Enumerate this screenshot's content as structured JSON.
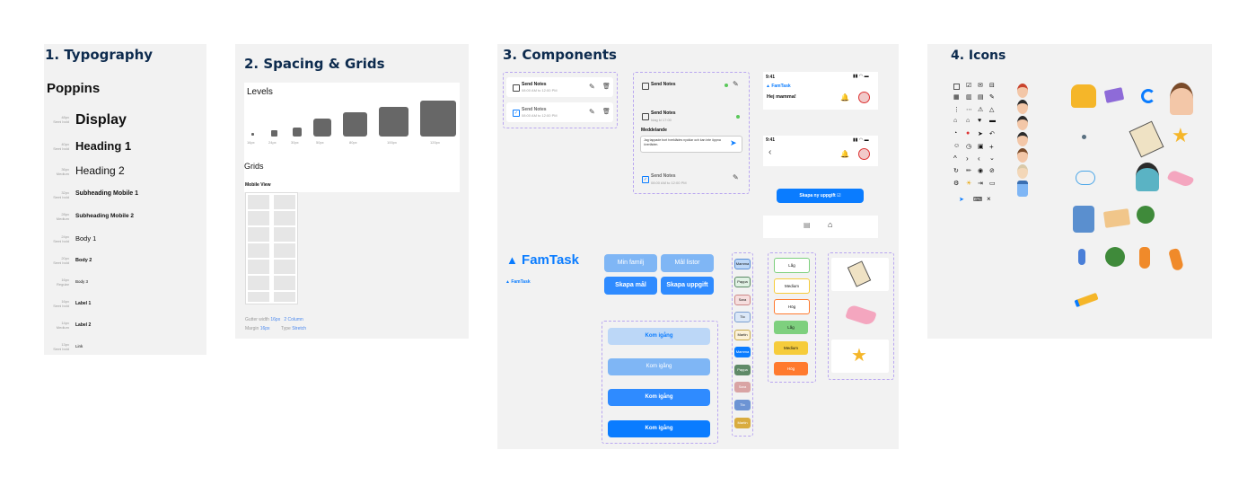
{
  "typography": {
    "title": "1. Typography",
    "font_name": "Poppins",
    "styles": [
      {
        "size": "48px",
        "weight": "Semi bold",
        "name": "Display"
      },
      {
        "size": "40px",
        "weight": "Semi bold",
        "name": "Heading 1"
      },
      {
        "size": "36px",
        "weight": "Medium",
        "name": "Heading 2"
      },
      {
        "size": "32px",
        "weight": "Semi bold",
        "name": "Subheading Mobile 1"
      },
      {
        "size": "28px",
        "weight": "Medium",
        "name": "Subheading Mobile 2"
      },
      {
        "size": "24px",
        "weight": "Semi bold",
        "name": "Body 1"
      },
      {
        "size": "20px",
        "weight": "Semi bold",
        "name": "Body 2"
      },
      {
        "size": "16px",
        "weight": "Regular",
        "name": "Body 3"
      },
      {
        "size": "16px",
        "weight": "Semi bold",
        "name": "Label 1"
      },
      {
        "size": "14px",
        "weight": "Medium",
        "name": "Label 2"
      },
      {
        "size": "13px",
        "weight": "Semi bold",
        "name": "Link"
      }
    ]
  },
  "spacing": {
    "title": "2. Spacing & Grids",
    "levels_title": "Levels",
    "levels": [
      "16px",
      "24px",
      "30px",
      "50px",
      "80px",
      "100px",
      "120px"
    ],
    "grids_title": "Grids",
    "mobile_view": "Mobile View",
    "gutter_label": "Gutter width",
    "gutter_value": "16px",
    "columns_value": "2 Column",
    "margin_label": "Margin",
    "margin_value": "16px",
    "type_label": "Type",
    "type_value": "Stretch"
  },
  "components": {
    "title": "3. Components",
    "note_title": "Send Notes",
    "note_time": "08:00 AM to 12:00 PM",
    "note_time_short": "Idag kl 17:00",
    "message_label": "Meddelande",
    "message_text": "Jag tappade bort tvreklädes nycklar och kan inte öppna överläden.",
    "phone_time": "9:41",
    "brand": "FamTask",
    "greeting": "Hej mamma!",
    "create_task": "Skapa ny uppgift",
    "brand_large": "FamTask",
    "tabs": [
      "Min familj",
      "Mål listor",
      "Skapa mål",
      "Skapa uppgift"
    ],
    "start_button": "Kom igång",
    "members": [
      "Mamma",
      "Pappa",
      "Sara",
      "Tio",
      "Martin",
      "Mamma",
      "Pappa",
      "Sara",
      "Tio",
      "Martin"
    ],
    "priorities": [
      "Låg",
      "Medium",
      "Hög",
      "Låg",
      "Medium",
      "Hög"
    ]
  },
  "icons": {
    "title": "4. Icons"
  },
  "colors": {
    "primary": "#0a7cff",
    "primary_light": "#7fb6f5",
    "primary_pale": "#bcd7f7",
    "navy": "#0d2b4e",
    "green": "#7ed07e",
    "yellow": "#f6cc3b",
    "orange": "#ff7a2e"
  }
}
